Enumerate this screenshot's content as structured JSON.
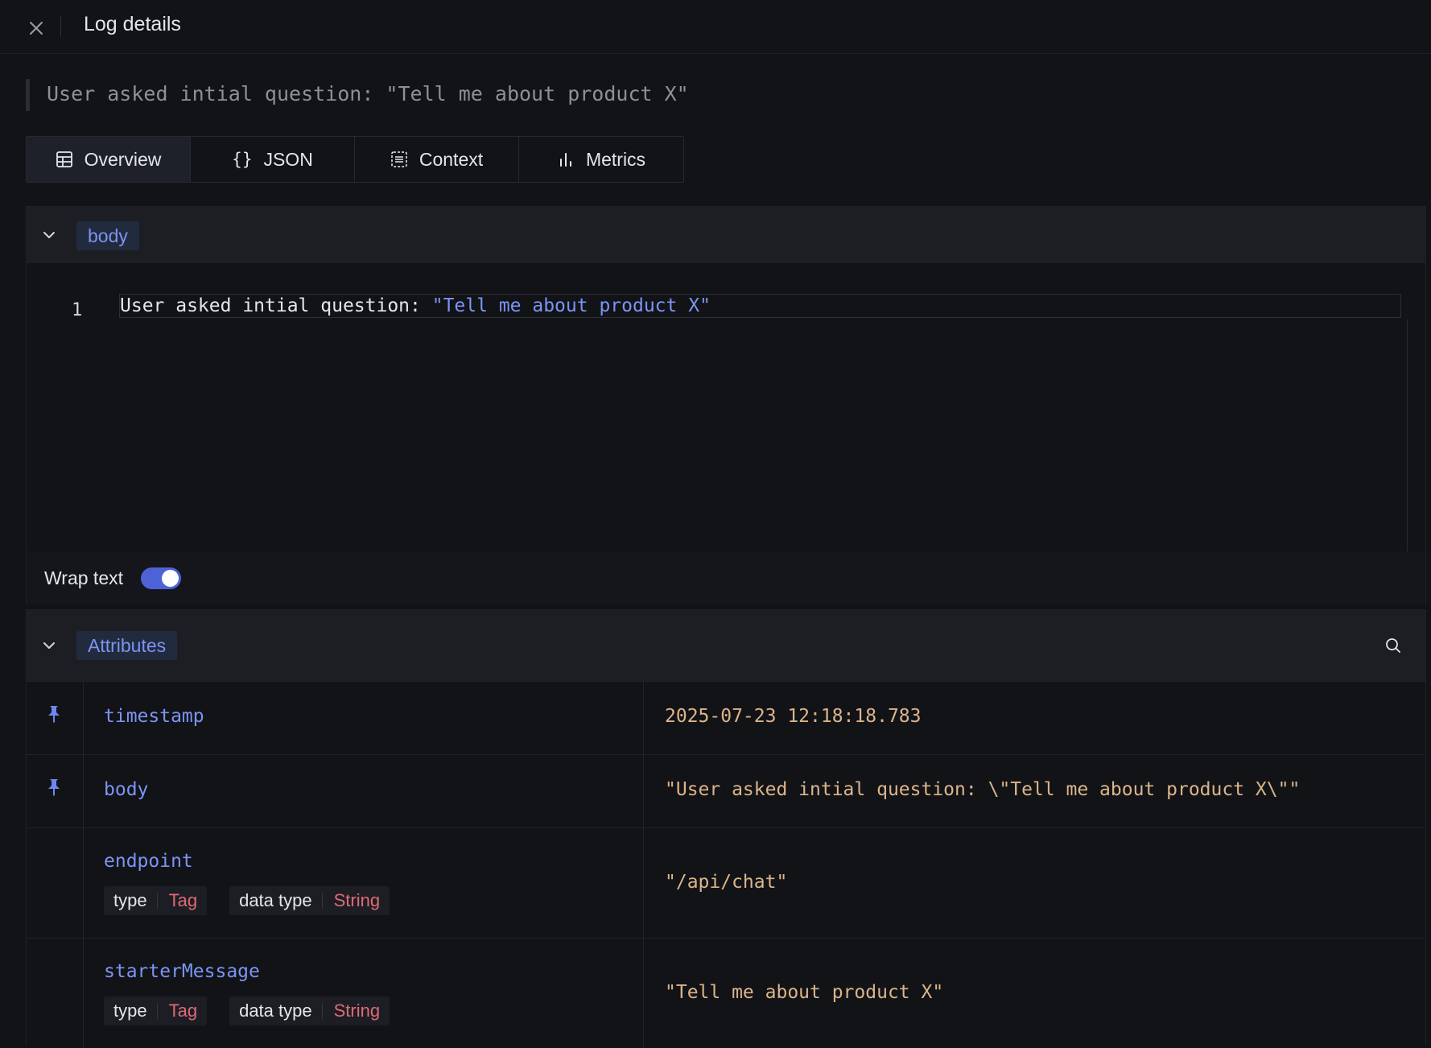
{
  "header": {
    "title": "Log details"
  },
  "summary": {
    "text": "User asked intial question: \"Tell me about product X\""
  },
  "tabs": [
    {
      "label": "Overview",
      "icon": "table-icon",
      "active": true
    },
    {
      "label": "JSON",
      "icon": "braces-icon",
      "active": false
    },
    {
      "label": "Context",
      "icon": "list-icon",
      "active": false
    },
    {
      "label": "Metrics",
      "icon": "bar-chart-icon",
      "active": false
    }
  ],
  "body_section": {
    "title": "body",
    "line_number": "1",
    "code_plain": "User asked intial question: ",
    "code_string": "\"Tell me about product X\"",
    "wrap_label": "Wrap text",
    "wrap_enabled": true
  },
  "attributes": {
    "title": "Attributes",
    "rows": [
      {
        "key": "timestamp",
        "value": "2025-07-23 12:18:18.783",
        "pinned": true
      },
      {
        "key": "body",
        "value": "\"User asked intial question: \\\"Tell me about product X\\\"\"",
        "pinned": true
      },
      {
        "key": "endpoint",
        "value": "\"/api/chat\"",
        "pinned": false,
        "type_label": "type",
        "type_value": "Tag",
        "dtype_label": "data type",
        "dtype_value": "String"
      },
      {
        "key": "starterMessage",
        "value": "\"Tell me about product X\"",
        "pinned": false,
        "type_label": "type",
        "type_value": "Tag",
        "dtype_label": "data type",
        "dtype_value": "String"
      }
    ]
  },
  "colors": {
    "accent": "#7c94f4",
    "value": "#dcb58a",
    "tag": "#e06a77",
    "toggle": "#4e62d8"
  }
}
